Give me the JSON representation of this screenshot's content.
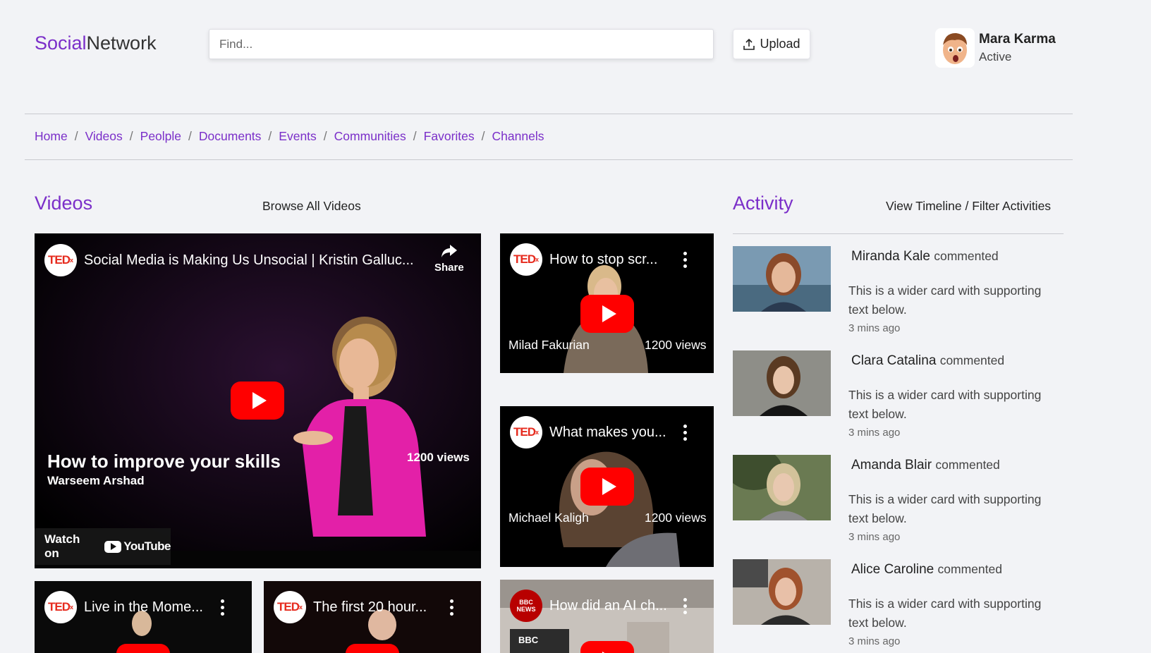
{
  "brand": {
    "part1": "Social",
    "part2": "Network"
  },
  "search": {
    "placeholder": "Find..."
  },
  "upload": {
    "label": "Upload"
  },
  "user": {
    "name": "Mara Karma",
    "status": "Active"
  },
  "breadcrumb": [
    "Home",
    "Videos",
    "Peolple",
    "Documents",
    "Events",
    "Communities",
    "Favorites",
    "Channels"
  ],
  "videos": {
    "title": "Videos",
    "browse_label": "Browse All Videos",
    "featured": {
      "channel": "TED",
      "title": "Social Media is Making Us Unsocial | Kristin Galluc...",
      "share_label": "Share",
      "caption": "How to improve your skills",
      "author": "Warseem Arshad",
      "views": "1200 views",
      "watch_on": "Watch on",
      "youtube": "YouTube"
    },
    "side": [
      {
        "channel": "TED",
        "title": "How to stop scr...",
        "author": "Milad Fakurian",
        "views": "1200 views"
      },
      {
        "channel": "TED",
        "title": "What makes you...",
        "author": "Michael Kaligh",
        "views": "1200 views"
      }
    ],
    "bottom": [
      {
        "channel": "TED",
        "title": "Live in the Mome..."
      },
      {
        "channel": "TED",
        "title": "The first 20 hour..."
      },
      {
        "channel": "BBC NEWS",
        "title": "How did an AI ch...",
        "badge": "BBC"
      }
    ]
  },
  "activity": {
    "title": "Activity",
    "links": "View Timeline / Filter Activities",
    "items": [
      {
        "name": "Miranda Kale",
        "action": "commented",
        "text": "This is a wider card with supporting text below.",
        "time": "3 mins ago"
      },
      {
        "name": "Clara Catalina",
        "action": "commented",
        "text": "This is a wider card with supporting text below.",
        "time": "3 mins ago"
      },
      {
        "name": "Amanda Blair",
        "action": "commented",
        "text": "This is a wider card with supporting text below.",
        "time": "3 mins ago"
      },
      {
        "name": "Alice Caroline",
        "action": "commented",
        "text": "This is a wider card with supporting text below.",
        "time": "3 mins ago"
      }
    ]
  },
  "colors": {
    "accent": "#7b2fc9",
    "background": "#f2f3f6",
    "youtube_red": "#ff0000",
    "ted_red": "#e62b1e"
  }
}
